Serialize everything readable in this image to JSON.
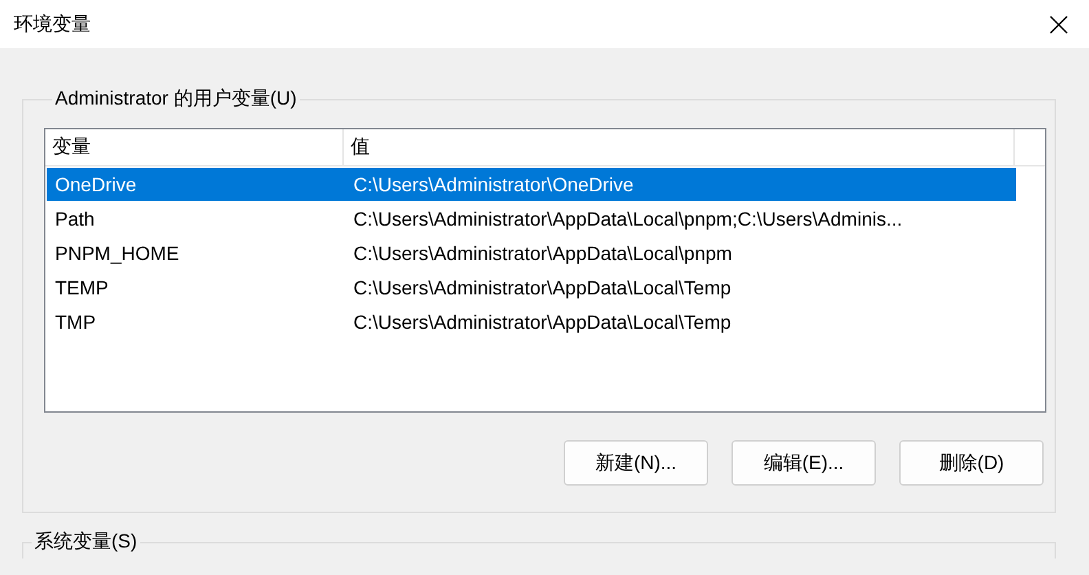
{
  "window": {
    "title": "环境变量"
  },
  "user_group": {
    "legend": "Administrator 的用户变量(U)",
    "table": {
      "columns": [
        "变量",
        "值"
      ],
      "rows": [
        {
          "name": "OneDrive",
          "value": "C:\\Users\\Administrator\\OneDrive",
          "selected": true
        },
        {
          "name": "Path",
          "value": "C:\\Users\\Administrator\\AppData\\Local\\pnpm;C:\\Users\\Adminis...",
          "selected": false
        },
        {
          "name": "PNPM_HOME",
          "value": "C:\\Users\\Administrator\\AppData\\Local\\pnpm",
          "selected": false
        },
        {
          "name": "TEMP",
          "value": "C:\\Users\\Administrator\\AppData\\Local\\Temp",
          "selected": false
        },
        {
          "name": "TMP",
          "value": "C:\\Users\\Administrator\\AppData\\Local\\Temp",
          "selected": false
        }
      ]
    },
    "buttons": [
      "新建(N)...",
      "编辑(E)...",
      "删除(D)"
    ]
  },
  "system_group": {
    "legend": "系统变量(S)"
  }
}
